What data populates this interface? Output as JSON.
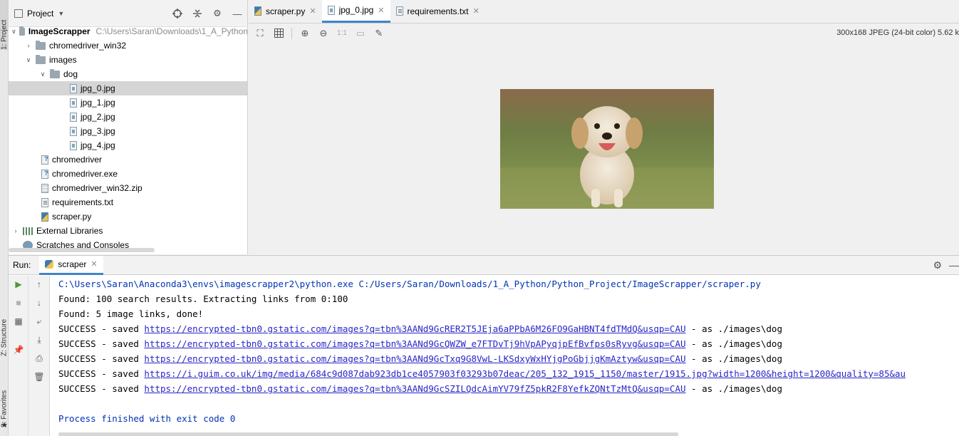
{
  "left_strip": {
    "project_tab": "1: Project",
    "structure_tab": "Z: Structure",
    "favorites_tab": "2: Favorites"
  },
  "project_panel": {
    "title": "Project",
    "tree": [
      {
        "label": "ImageScrapper",
        "path": "C:\\Users\\Saran\\Downloads\\1_A_Python",
        "type": "folder",
        "expanded": true,
        "depth": 0
      },
      {
        "label": "chromedriver_win32",
        "type": "folder",
        "expanded": false,
        "depth": 1
      },
      {
        "label": "images",
        "type": "folder",
        "expanded": true,
        "depth": 1
      },
      {
        "label": "dog",
        "type": "folder",
        "expanded": true,
        "depth": 2
      },
      {
        "label": "jpg_0.jpg",
        "type": "image",
        "depth": 3,
        "selected": true
      },
      {
        "label": "jpg_1.jpg",
        "type": "image",
        "depth": 3
      },
      {
        "label": "jpg_2.jpg",
        "type": "image",
        "depth": 3
      },
      {
        "label": "jpg_3.jpg",
        "type": "image",
        "depth": 3
      },
      {
        "label": "jpg_4.jpg",
        "type": "image",
        "depth": 3
      },
      {
        "label": "chromedriver",
        "type": "unknown",
        "depth": 1
      },
      {
        "label": "chromedriver.exe",
        "type": "unknown",
        "depth": 1
      },
      {
        "label": "chromedriver_win32.zip",
        "type": "zip",
        "depth": 1
      },
      {
        "label": "requirements.txt",
        "type": "text",
        "depth": 1
      },
      {
        "label": "scraper.py",
        "type": "python",
        "depth": 1
      },
      {
        "label": "External Libraries",
        "type": "libraries",
        "depth": 0
      },
      {
        "label": "Scratches and Consoles",
        "type": "scratches",
        "depth": 0
      }
    ]
  },
  "editor": {
    "tabs": [
      {
        "label": "scraper.py",
        "icon": "python-file-icon",
        "active": false
      },
      {
        "label": "jpg_0.jpg",
        "icon": "image-file-icon",
        "active": true
      },
      {
        "label": "requirements.txt",
        "icon": "text-file-icon",
        "active": false
      }
    ],
    "image_info": "300x168 JPEG (24-bit color) 5.62 k",
    "zoom_reset_label": "1:1"
  },
  "run_panel": {
    "label": "Run:",
    "tab_label": "scraper",
    "console": {
      "command": "C:\\Users\\Saran\\Anaconda3\\envs\\imagescrapper2\\python.exe C:/Users/Saran/Downloads/1_A_Python/Python_Project/ImageScrapper/scraper.py",
      "found_results": "Found: 100 search results. Extracting links from 0:100",
      "found_links": "Found: 5 image links, done!",
      "saved_prefix": "SUCCESS - saved ",
      "saved_suffix": " - as ./images\\dog",
      "saved": [
        {
          "url": "https://encrypted-tbn0.gstatic.com/images?q=tbn%3AANd9GcRER2T5JEja6aPPbA6M26FO9GaHBNT4fdTMdQ&usqp=CAU",
          "suffix": " - as ./images\\dog"
        },
        {
          "url": "https://encrypted-tbn0.gstatic.com/images?q=tbn%3AANd9GcQWZW_e7FTDvTj9hVpAPyqjpEfBvfps0sRyvg&usqp=CAU",
          "suffix": " - as ./images\\dog"
        },
        {
          "url": "https://encrypted-tbn0.gstatic.com/images?q=tbn%3AANd9GcTxq9G8VwL-LKSdxyWxHYjgPoGbjjgKmAztyw&usqp=CAU",
          "suffix": " - as ./images\\dog"
        },
        {
          "url": "https://i.guim.co.uk/img/media/684c9d087dab923db1ce4057903f03293b07deac/205_132_1915_1150/master/1915.jpg?width=1200&height=1200&quality=85&au",
          "suffix": ""
        },
        {
          "url": "https://encrypted-tbn0.gstatic.com/images?q=tbn%3AANd9GcSZILQdcAimYV79fZ5pkR2F8YefkZQNtTzMtQ&usqp=CAU",
          "suffix": " - as ./images\\dog"
        }
      ],
      "exit": "Process finished with exit code 0"
    }
  },
  "colors": {
    "accent": "#4083c9",
    "console_command": "#0033b3",
    "console_link": "#2a24c8",
    "selection": "#d5d5d5"
  }
}
